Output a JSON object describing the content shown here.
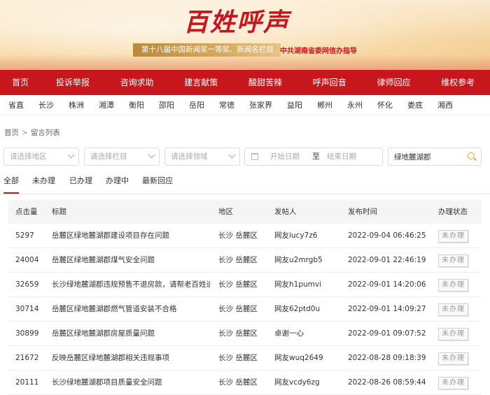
{
  "banner": {
    "title": "百姓呼声",
    "award": "第十八届中国新闻奖一等奖、新闻名栏目",
    "guide": "中共湖南省委网信办指导"
  },
  "main_nav": [
    "首页",
    "投诉举报",
    "咨询求助",
    "建言献策",
    "酸甜苦辣",
    "呼声回音",
    "律师回应",
    "维权参考"
  ],
  "regions": [
    "省直",
    "长沙",
    "株洲",
    "湘潭",
    "衡阳",
    "邵阳",
    "岳阳",
    "常德",
    "张家界",
    "益阳",
    "郴州",
    "永州",
    "怀化",
    "娄底",
    "湘西"
  ],
  "breadcrumb": {
    "home": "首页",
    "separator": ">",
    "current": "留言列表"
  },
  "filters": {
    "region_placeholder": "请选择地区",
    "column_placeholder": "请选择栏目",
    "domain_placeholder": "请选择领域",
    "start_date_placeholder": "开始日期",
    "date_separator": "至",
    "end_date_placeholder": "结束日期",
    "search_value": "绿地麓湖郡"
  },
  "tabs": [
    "全部",
    "未办理",
    "已办理",
    "办理中",
    "最新回应"
  ],
  "active_tab": "全部",
  "table": {
    "headers": {
      "views": "点击量",
      "title": "标题",
      "area": "地区",
      "poster": "发帖人",
      "time": "发布时间",
      "status": "办理状态"
    },
    "rows": [
      {
        "views": "5297",
        "title": "岳麓区绿地麓湖郡建设项目存在问题",
        "area": "长沙 岳麓区",
        "poster": "网友iucy7z6",
        "time": "2022-09-04 06:46:25",
        "status": "未办理"
      },
      {
        "views": "24004",
        "title": "岳麓区绿地麓湖郡煤气安全问题",
        "area": "长沙 岳麓区",
        "poster": "网友u2mrgb5",
        "time": "2022-09-01 22:46:19",
        "status": "未办理"
      },
      {
        "views": "32659",
        "title": "长沙绿地麓湖郡违规预售不退房款，请帮老百姓追...",
        "area": "长沙 岳麓区",
        "poster": "网友h1pumvi",
        "time": "2022-09-01 14:20:06",
        "status": "未办理"
      },
      {
        "views": "30714",
        "title": "岳麓区绿地麓湖郡燃气管道安装不合格",
        "area": "长沙 岳麓区",
        "poster": "网友62ptd0u",
        "time": "2022-09-01 14:09:27",
        "status": "未办理"
      },
      {
        "views": "30899",
        "title": "岳麓区绿地麓湖郡房屋质量问题",
        "area": "长沙 岳麓区",
        "poster": "卓谢一心",
        "time": "2022-09-01 09:07:52",
        "status": "未办理"
      },
      {
        "views": "21672",
        "title": "反映岳麓区绿地麓湖郡相关违规事项",
        "area": "长沙 岳麓区",
        "poster": "网友wuq2649",
        "time": "2022-08-28 09:18:39",
        "status": "未办理"
      },
      {
        "views": "20111",
        "title": "长沙绿地麓湖郡项目质量安全问题",
        "area": "长沙 岳麓区",
        "poster": "网友vcdy6zg",
        "time": "2022-08-26 08:59:44",
        "status": "未办理"
      }
    ]
  },
  "colors": {
    "brand_red": "#c8161d",
    "gold": "#c99a4b",
    "search_icon": "#e0a030"
  }
}
